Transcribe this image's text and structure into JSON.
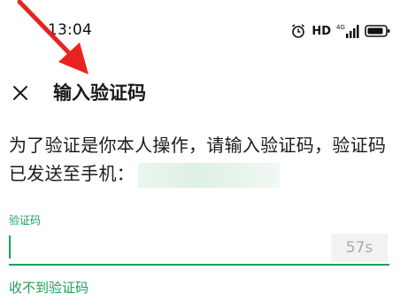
{
  "status_bar": {
    "time": "13:04",
    "hd_label": "HD",
    "network_label": "4G",
    "icons": [
      "alarm-icon",
      "signal-icon",
      "battery-icon"
    ]
  },
  "header": {
    "title": "输入验证码",
    "close_icon": "close-icon"
  },
  "description": {
    "text": "为了验证是你本人操作，请输入验证码，验证码已发送至手机："
  },
  "code_field": {
    "label": "验证码",
    "value": "",
    "countdown": "57s"
  },
  "links": {
    "no_code": "收不到验证码"
  },
  "colors": {
    "accent": "#1aa05b",
    "annotation": "#e8231f"
  }
}
